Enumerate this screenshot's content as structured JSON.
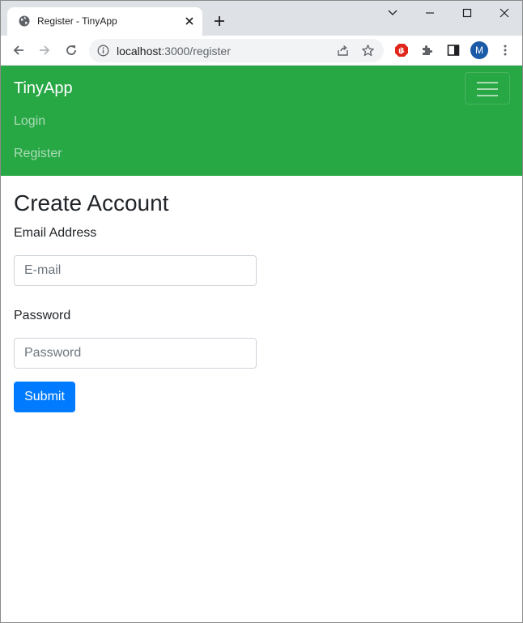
{
  "browser": {
    "tab_title": "Register - TinyApp",
    "url_host": "localhost",
    "url_path": ":3000/register",
    "profile_initial": "M"
  },
  "navbar": {
    "brand": "TinyApp",
    "links": [
      "Login",
      "Register"
    ],
    "color": "#28a745"
  },
  "form": {
    "title": "Create Account",
    "email_label": "Email Address",
    "email_placeholder": "E-mail",
    "password_label": "Password",
    "password_placeholder": "Password",
    "submit_label": "Submit",
    "submit_color": "#007bff"
  }
}
